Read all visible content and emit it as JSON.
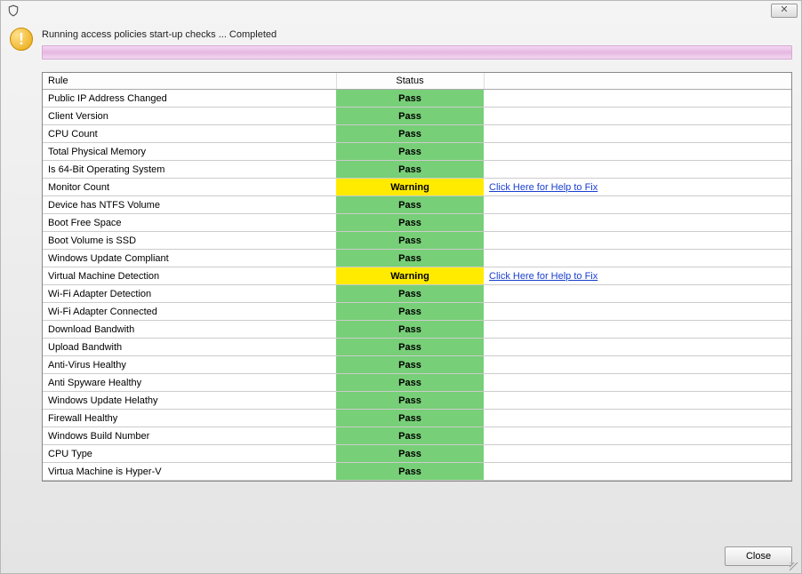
{
  "window": {
    "close_x_label": "✕"
  },
  "header": {
    "status_text": "Running access policies start-up checks ... Completed"
  },
  "table": {
    "headers": {
      "rule": "Rule",
      "status": "Status",
      "action": ""
    },
    "help_link_text": "Click Here for Help to Fix",
    "rows": [
      {
        "rule": "Public IP Address Changed",
        "status": "Pass",
        "status_class": "pass",
        "help": false
      },
      {
        "rule": "Client Version",
        "status": "Pass",
        "status_class": "pass",
        "help": false
      },
      {
        "rule": "CPU Count",
        "status": "Pass",
        "status_class": "pass",
        "help": false
      },
      {
        "rule": "Total Physical Memory",
        "status": "Pass",
        "status_class": "pass",
        "help": false
      },
      {
        "rule": "Is 64-Bit Operating System",
        "status": "Pass",
        "status_class": "pass",
        "help": false
      },
      {
        "rule": "Monitor Count",
        "status": "Warning",
        "status_class": "warning",
        "help": true
      },
      {
        "rule": "Device has NTFS Volume",
        "status": "Pass",
        "status_class": "pass",
        "help": false
      },
      {
        "rule": "Boot Free Space",
        "status": "Pass",
        "status_class": "pass",
        "help": false
      },
      {
        "rule": "Boot Volume is SSD",
        "status": "Pass",
        "status_class": "pass",
        "help": false
      },
      {
        "rule": "Windows Update Compliant",
        "status": "Pass",
        "status_class": "pass",
        "help": false
      },
      {
        "rule": "Virtual Machine Detection",
        "status": "Warning",
        "status_class": "warning",
        "help": true
      },
      {
        "rule": "Wi-Fi Adapter Detection",
        "status": "Pass",
        "status_class": "pass",
        "help": false
      },
      {
        "rule": "Wi-Fi Adapter Connected",
        "status": "Pass",
        "status_class": "pass",
        "help": false
      },
      {
        "rule": "Download Bandwith",
        "status": "Pass",
        "status_class": "pass",
        "help": false
      },
      {
        "rule": "Upload Bandwith",
        "status": "Pass",
        "status_class": "pass",
        "help": false
      },
      {
        "rule": "Anti-Virus Healthy",
        "status": "Pass",
        "status_class": "pass",
        "help": false
      },
      {
        "rule": "Anti Spyware Healthy",
        "status": "Pass",
        "status_class": "pass",
        "help": false
      },
      {
        "rule": "Windows Update Helathy",
        "status": "Pass",
        "status_class": "pass",
        "help": false
      },
      {
        "rule": "Firewall Healthy",
        "status": "Pass",
        "status_class": "pass",
        "help": false
      },
      {
        "rule": "Windows Build Number",
        "status": "Pass",
        "status_class": "pass",
        "help": false
      },
      {
        "rule": "CPU Type",
        "status": "Pass",
        "status_class": "pass",
        "help": false
      },
      {
        "rule": "Virtua Machine is Hyper-V",
        "status": "Pass",
        "status_class": "pass",
        "help": false
      }
    ]
  },
  "footer": {
    "close_label": "Close"
  }
}
